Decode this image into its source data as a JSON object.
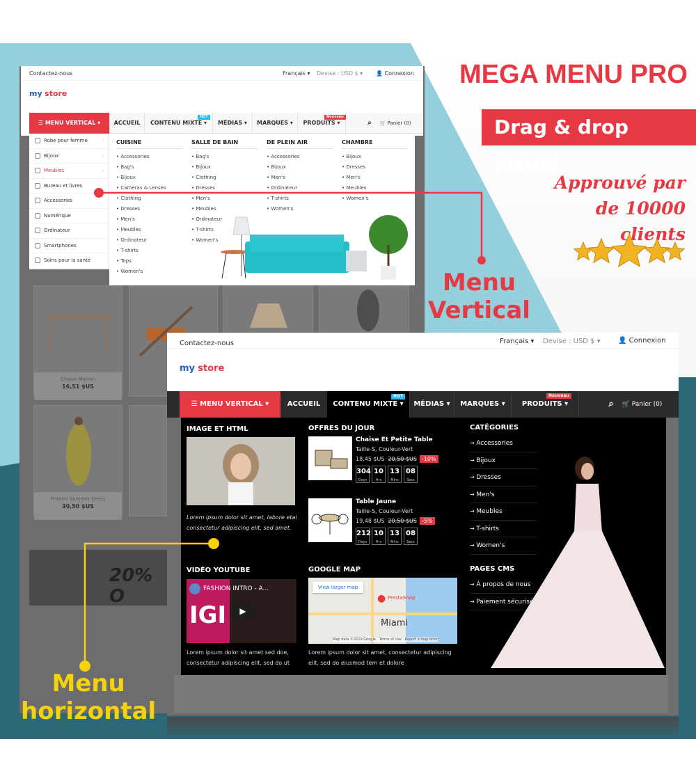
{
  "promo": {
    "title": "MEGA MENU PRO",
    "subtitle": "Drag & drop visuel",
    "tagline_line1": "Approuvé par",
    "tagline_line2": "de 10000 clients",
    "rating_stars": 5,
    "label_vertical_1": "Menu",
    "label_vertical_2": "Vertical",
    "label_horizontal_1": "Menu",
    "label_horizontal_2": "horizontal",
    "colors": {
      "accent_red": "#e63946",
      "accent_yellow": "#f5d20b",
      "bg_blue": "#95cfdc",
      "bg_teal": "#2e6877"
    }
  },
  "store": {
    "contact": "Contactez-nous",
    "language": "Français",
    "currency": "Devise : USD $",
    "login": "Connexion",
    "logo_my": "my",
    "logo_store": "store",
    "cart": "Panier (0)",
    "nav": {
      "vertical": "MENU VERTICAL",
      "home": "ACCUEIL",
      "mixed": "CONTENU MIXTE",
      "mixed_badge": "HOT",
      "media": "MÉDIAS",
      "brands": "MARQUES",
      "products": "PRODUITS",
      "products_badge": "Nouveau"
    }
  },
  "vertical_menu": {
    "items": [
      {
        "label": "Robe pour femme",
        "icon": "dress-icon",
        "has_sub": true
      },
      {
        "label": "Bijoux",
        "icon": "diamond-icon",
        "has_sub": true
      },
      {
        "label": "Meubles",
        "icon": "headphones-icon",
        "has_sub": true,
        "active": true
      },
      {
        "label": "Bureau et livres",
        "icon": "books-icon",
        "has_sub": false
      },
      {
        "label": "Accessories",
        "icon": "hanger-icon",
        "has_sub": false
      },
      {
        "label": "Numérique",
        "icon": "camera-icon",
        "has_sub": false
      },
      {
        "label": "Ordinateur",
        "icon": "monitor-icon",
        "has_sub": false
      },
      {
        "label": "Smartphones",
        "icon": "phone-icon",
        "has_sub": false
      },
      {
        "label": "Soins pour la santé",
        "icon": "health-icon",
        "has_sub": false
      }
    ],
    "columns": [
      {
        "title": "CUISINE",
        "items": [
          "Accessories",
          "Bag's",
          "Bijoux",
          "Cameras & Lenses",
          "Clothing",
          "Dresses",
          "Men's",
          "Meubles",
          "Ordinateur",
          "T-shirts",
          "Tops",
          "Women's"
        ]
      },
      {
        "title": "SALLE DE BAIN",
        "items": [
          "Bag's",
          "Bijoux",
          "Clothing",
          "Dresses",
          "Men's",
          "Meubles",
          "Ordinateur",
          "T-shirts",
          "Women's"
        ]
      },
      {
        "title": "DE PLEIN AIR",
        "items": [
          "Accessories",
          "Bijoux",
          "Men's",
          "Ordinateur",
          "T-shirts",
          "Women's"
        ]
      },
      {
        "title": "CHAMBRE",
        "items": [
          "Bijoux",
          "Dresses",
          "Men's",
          "Meubles",
          "Women's"
        ]
      }
    ]
  },
  "background_products": [
    {
      "name": "Chaise Marron",
      "price": "16,51 $US"
    },
    {
      "name": "Printed Summer Dress",
      "price": "30,50 $US"
    },
    {
      "banner": "20% O"
    }
  ],
  "horizontal_menu": {
    "image_html": {
      "title": "IMAGE ET HTML",
      "text": "Lorem ipsum dolor sit amet, labore etai consectetur adipiscing elit, sed amet."
    },
    "offers": {
      "title": "OFFRES DU JOUR",
      "items": [
        {
          "name": "Chaise Et Petite Table",
          "variant": "Taille-S, Couleur-Vert",
          "price": "18,45 $US",
          "old_price": "20,50 $US",
          "discount": "-10%",
          "countdown": {
            "days": "304",
            "hrs": "10",
            "mins": "13",
            "secs": "08"
          }
        },
        {
          "name": "Table Jaune",
          "variant": "Taille-S, Couleur-Vert",
          "price": "19,48 $US",
          "old_price": "20,50 $US",
          "discount": "-5%",
          "countdown": {
            "days": "212",
            "hrs": "10",
            "mins": "13",
            "secs": "08"
          }
        }
      ],
      "labels": {
        "days": "Days",
        "hrs": "Hrs",
        "mins": "Mins",
        "secs": "Secs"
      }
    },
    "categories": {
      "title": "CATÉGORIES",
      "items": [
        "Accessories",
        "Bijoux",
        "Dresses",
        "Men's",
        "Meubles",
        "T-shirts",
        "Women's"
      ]
    },
    "cms": {
      "title": "PAGES CMS",
      "items": [
        "À propos de nous",
        "Paiement sécurisé"
      ]
    },
    "video": {
      "title": "VIDÉO YOUTUBE",
      "video_title": "FASHION INTRO - A...",
      "text": "Lorem ipsum dolor sit amet sed doe, consectetur adipiscing elit, sed do ut"
    },
    "map": {
      "title": "GOOGLE MAP",
      "link": "View larger map",
      "marker": "PrestaShop",
      "city": "Miami",
      "footer": "Map data ©2019 Google   Terms of Use   Report a map error",
      "text": "Lorem ipsum dolor sit amet, consectetur adipiscing elit, sed do eiusmod tem et dolore"
    }
  }
}
